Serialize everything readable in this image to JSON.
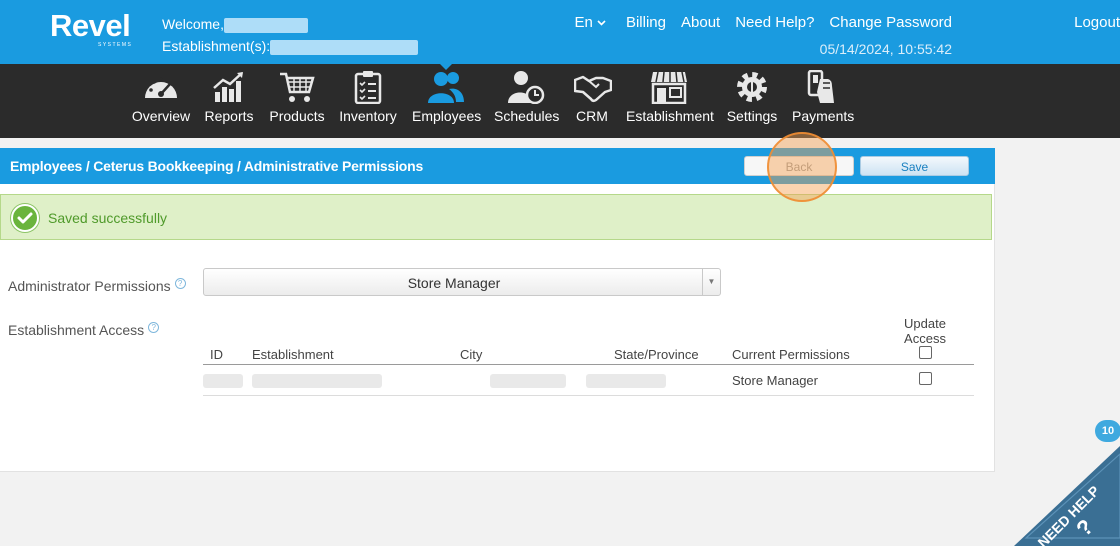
{
  "brand": {
    "name": "Revel",
    "sub": "SYSTEMS"
  },
  "header": {
    "welcome_label": "Welcome,",
    "establishment_label": "Establishment(s):",
    "language": "En",
    "links": [
      "Billing",
      "About",
      "Need Help?",
      "Change Password",
      "Logout"
    ],
    "datetime": "05/14/2024, 10:55:42"
  },
  "modules": [
    {
      "label": "Overview",
      "icon": "speedometer-icon"
    },
    {
      "label": "Reports",
      "icon": "chart-icon"
    },
    {
      "label": "Products",
      "icon": "cart-icon"
    },
    {
      "label": "Inventory",
      "icon": "clipboard-icon"
    },
    {
      "label": "Employees",
      "icon": "people-icon",
      "active": true
    },
    {
      "label": "Schedules",
      "icon": "person-clock-icon"
    },
    {
      "label": "CRM",
      "icon": "handshake-icon"
    },
    {
      "label": "Establishment",
      "icon": "store-icon"
    },
    {
      "label": "Settings",
      "icon": "gear-icon"
    },
    {
      "label": "Payments",
      "icon": "card-icon"
    }
  ],
  "page": {
    "breadcrumb": "Employees / Ceterus Bookkeeping / Administrative Permissions",
    "back_label": "Back",
    "save_label": "Save",
    "alert": "Saved successfully",
    "admin_permissions_label": "Administrator Permissions",
    "admin_permissions_value": "Store Manager",
    "establishment_access_label": "Establishment Access",
    "table": {
      "columns": [
        "ID",
        "Establishment",
        "City",
        "State/Province",
        "Current Permissions",
        "Update Access"
      ],
      "rows": [
        {
          "current_permissions": "Store Manager",
          "update_access": false
        }
      ]
    }
  },
  "need_help": {
    "label": "NEED HELP",
    "badge": "10"
  },
  "colors": {
    "brand_blue": "#1a9be0",
    "nav_dark": "#2b2b2b",
    "success_green": "#6ab43d"
  }
}
